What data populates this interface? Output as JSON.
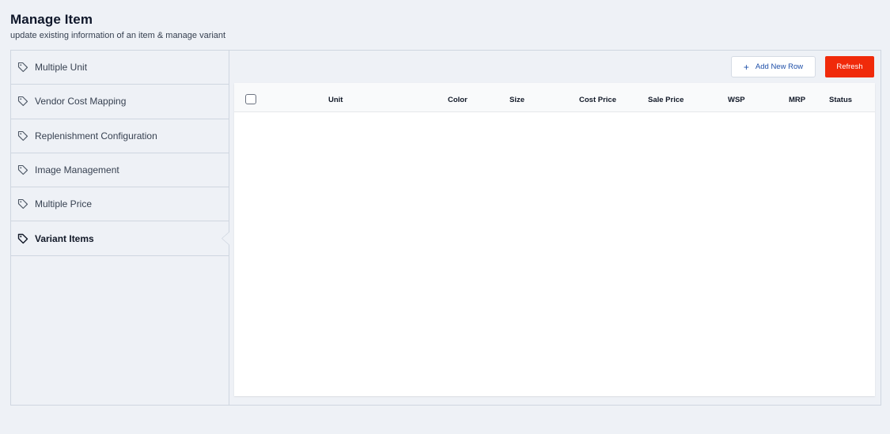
{
  "header": {
    "title": "Manage Item",
    "subtitle": "update existing information of an item & manage variant"
  },
  "sidebar": {
    "items": [
      {
        "label": "Multiple Unit",
        "icon": "tag-icon",
        "active": false
      },
      {
        "label": "Vendor Cost Mapping",
        "icon": "tag-icon",
        "active": false
      },
      {
        "label": "Replenishment Configuration",
        "icon": "tag-icon",
        "active": false
      },
      {
        "label": "Image Management",
        "icon": "tag-icon",
        "active": false
      },
      {
        "label": "Multiple Price",
        "icon": "tag-icon",
        "active": false
      },
      {
        "label": "Variant Items",
        "icon": "tag-icon",
        "active": true
      }
    ]
  },
  "toolbar": {
    "add_label": "Add New Row",
    "refresh_label": "Refresh"
  },
  "grid": {
    "columns": [
      "Unit",
      "Color",
      "Size",
      "Cost Price",
      "Sale Price",
      "WSP",
      "MRP",
      "Status"
    ],
    "rows": []
  },
  "colors": {
    "accent_red": "#f02a0a",
    "link_blue": "#1e4fa8",
    "background": "#eef1f6"
  }
}
